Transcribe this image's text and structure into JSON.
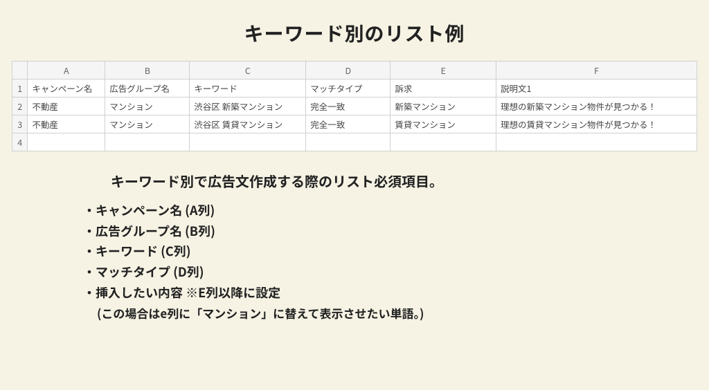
{
  "title": "キーワード別のリスト例",
  "columns": [
    "A",
    "B",
    "C",
    "D",
    "E",
    "F"
  ],
  "headers": [
    "キャンペーン名",
    "広告グループ名",
    "キーワード",
    "マッチタイプ",
    "訴求",
    "説明文1"
  ],
  "rows": [
    [
      "不動産",
      "マンション",
      "渋谷区 新築マンション",
      "完全一致",
      "新築マンション",
      "理想の新築マンション物件が見つかる！"
    ],
    [
      "不動産",
      "マンション",
      "渋谷区 賃貸マンション",
      "完全一致",
      "賃貸マンション",
      "理想の賃貸マンション物件が見つかる！"
    ]
  ],
  "row_numbers": [
    "1",
    "2",
    "3",
    "4"
  ],
  "subtitle": "キーワード別で広告文作成する際のリスト必須項目。",
  "bullets": [
    "キャンペーン名 (A列)",
    "広告グループ名 (B列)",
    "キーワード (C列)",
    "マッチタイプ (D列)",
    "挿入したい内容 ※E列以降に設定"
  ],
  "note": "(この場合はe列に「マンション」に替えて表示させたい単語。)"
}
